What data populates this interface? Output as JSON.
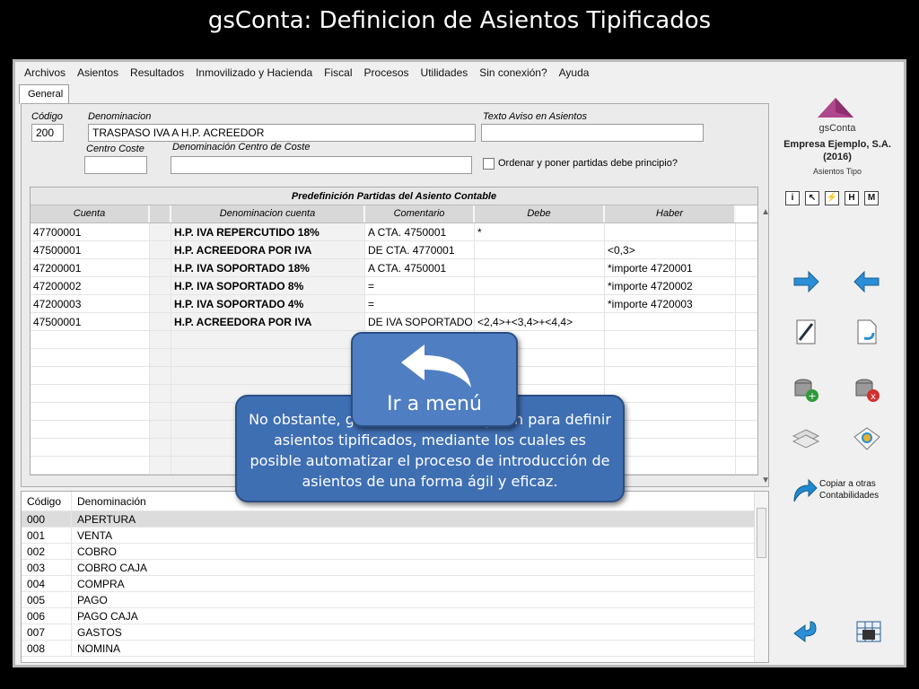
{
  "slide": {
    "title": "gsConta: Definicion de Asientos Tipificados"
  },
  "menubar": {
    "items": [
      "Archivos",
      "Asientos",
      "Resultados",
      "Inmovilizado y Hacienda",
      "Fiscal",
      "Procesos",
      "Utilidades",
      "Sin conexión?",
      "Ayuda"
    ]
  },
  "tab": {
    "label": "General"
  },
  "form": {
    "codigo_label": "Código",
    "codigo_value": "200",
    "denominacion_label": "Denominacion",
    "denominacion_value": "TRASPASO IVA A H.P. ACREEDOR",
    "aviso_label": "Texto Aviso en Asientos",
    "aviso_value": "",
    "centro_label": "Centro Coste",
    "centro_value": "",
    "centro_denom_label": "Denominación Centro de Coste",
    "centro_denom_value": "",
    "checkbox_label": "Ordenar y poner partidas debe principio?",
    "checkbox_checked": false
  },
  "grid": {
    "title": "Predefinición Partidas del Asiento Contable",
    "headers": [
      "Cuenta",
      "",
      "Denominacion cuenta",
      "Comentario",
      "Debe",
      "Haber"
    ],
    "rows": [
      [
        "47700001",
        "",
        "H.P. IVA REPERCUTIDO 18%",
        "A CTA. 4750001",
        "*",
        ""
      ],
      [
        "47500001",
        "",
        "H.P. ACREEDORA POR IVA",
        "DE CTA.  4770001",
        "",
        "<0,3>"
      ],
      [
        "47200001",
        "",
        "H.P. IVA SOPORTADO 18%",
        "A CTA. 4750001",
        "",
        "*importe 4720001"
      ],
      [
        "47200002",
        "",
        "H.P. IVA SOPORTADO 8%",
        "=",
        "",
        "*importe 4720002"
      ],
      [
        "47200003",
        "",
        "H.P. IVA SOPORTADO 4%",
        "=",
        "",
        "*importe 4720003"
      ],
      [
        "47500001",
        "",
        "H.P. ACREEDORA POR IVA",
        "DE IVA SOPORTADO",
        "<2,4>+<3,4>+<4,4>",
        ""
      ]
    ]
  },
  "list": {
    "headers": [
      "Código",
      "Denominación"
    ],
    "rows": [
      [
        "000",
        "APERTURA"
      ],
      [
        "001",
        "VENTA"
      ],
      [
        "002",
        "COBRO"
      ],
      [
        "003",
        "COBRO CAJA"
      ],
      [
        "004",
        "COMPRA"
      ],
      [
        "005",
        "PAGO"
      ],
      [
        "006",
        "PAGO CAJA"
      ],
      [
        "007",
        "GASTOS"
      ],
      [
        "008",
        "NOMINA"
      ]
    ],
    "selected_index": 0
  },
  "sidebar": {
    "brand": "gsConta",
    "company": "Empresa Ejemplo, S.A.",
    "year": "(2016)",
    "subtitle": "Asientos Tipo",
    "mini_buttons": [
      "i",
      "↖",
      "⚡",
      "H",
      "M"
    ],
    "copy_label_line1": "Copiar a otras",
    "copy_label_line2": "Contabilidades",
    "icons": [
      "arrow-right-icon",
      "arrow-left-icon",
      "edit-document-icon",
      "undo-document-icon",
      "add-database-icon",
      "delete-database-icon",
      "layers-icon",
      "print-preview-icon",
      "copy-arrow-icon",
      "return-icon",
      "calculator-grid-icon"
    ]
  },
  "callout": {
    "text": "No obstante, gsConta ofrece la opción para definir asientos tipificados, mediante los cuales es posible automatizar el proceso de introducción de asientos de una forma ágil y eficaz."
  },
  "menu_button": {
    "label": "Ir a menú"
  },
  "colors": {
    "callout": "#3f6fb3",
    "menu_button": "#4f7ec2",
    "accent_blue": "#2a8fd6"
  }
}
